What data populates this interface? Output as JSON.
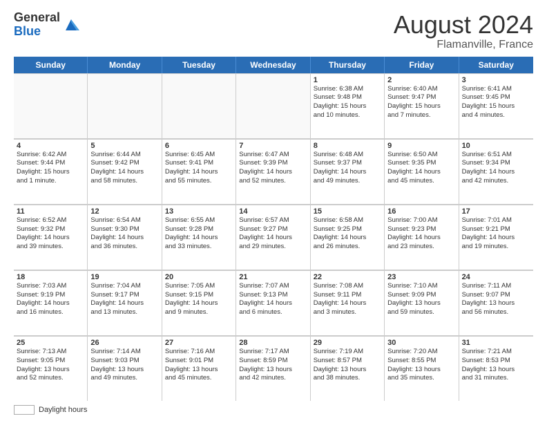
{
  "header": {
    "logo_general": "General",
    "logo_blue": "Blue",
    "month_year": "August 2024",
    "location": "Flamanville, France"
  },
  "calendar": {
    "days_of_week": [
      "Sunday",
      "Monday",
      "Tuesday",
      "Wednesday",
      "Thursday",
      "Friday",
      "Saturday"
    ],
    "rows": [
      [
        {
          "day": "",
          "lines": []
        },
        {
          "day": "",
          "lines": []
        },
        {
          "day": "",
          "lines": []
        },
        {
          "day": "",
          "lines": []
        },
        {
          "day": "1",
          "lines": [
            "Sunrise: 6:38 AM",
            "Sunset: 9:48 PM",
            "Daylight: 15 hours",
            "and 10 minutes."
          ]
        },
        {
          "day": "2",
          "lines": [
            "Sunrise: 6:40 AM",
            "Sunset: 9:47 PM",
            "Daylight: 15 hours",
            "and 7 minutes."
          ]
        },
        {
          "day": "3",
          "lines": [
            "Sunrise: 6:41 AM",
            "Sunset: 9:45 PM",
            "Daylight: 15 hours",
            "and 4 minutes."
          ]
        }
      ],
      [
        {
          "day": "4",
          "lines": [
            "Sunrise: 6:42 AM",
            "Sunset: 9:44 PM",
            "Daylight: 15 hours",
            "and 1 minute."
          ]
        },
        {
          "day": "5",
          "lines": [
            "Sunrise: 6:44 AM",
            "Sunset: 9:42 PM",
            "Daylight: 14 hours",
            "and 58 minutes."
          ]
        },
        {
          "day": "6",
          "lines": [
            "Sunrise: 6:45 AM",
            "Sunset: 9:41 PM",
            "Daylight: 14 hours",
            "and 55 minutes."
          ]
        },
        {
          "day": "7",
          "lines": [
            "Sunrise: 6:47 AM",
            "Sunset: 9:39 PM",
            "Daylight: 14 hours",
            "and 52 minutes."
          ]
        },
        {
          "day": "8",
          "lines": [
            "Sunrise: 6:48 AM",
            "Sunset: 9:37 PM",
            "Daylight: 14 hours",
            "and 49 minutes."
          ]
        },
        {
          "day": "9",
          "lines": [
            "Sunrise: 6:50 AM",
            "Sunset: 9:35 PM",
            "Daylight: 14 hours",
            "and 45 minutes."
          ]
        },
        {
          "day": "10",
          "lines": [
            "Sunrise: 6:51 AM",
            "Sunset: 9:34 PM",
            "Daylight: 14 hours",
            "and 42 minutes."
          ]
        }
      ],
      [
        {
          "day": "11",
          "lines": [
            "Sunrise: 6:52 AM",
            "Sunset: 9:32 PM",
            "Daylight: 14 hours",
            "and 39 minutes."
          ]
        },
        {
          "day": "12",
          "lines": [
            "Sunrise: 6:54 AM",
            "Sunset: 9:30 PM",
            "Daylight: 14 hours",
            "and 36 minutes."
          ]
        },
        {
          "day": "13",
          "lines": [
            "Sunrise: 6:55 AM",
            "Sunset: 9:28 PM",
            "Daylight: 14 hours",
            "and 33 minutes."
          ]
        },
        {
          "day": "14",
          "lines": [
            "Sunrise: 6:57 AM",
            "Sunset: 9:27 PM",
            "Daylight: 14 hours",
            "and 29 minutes."
          ]
        },
        {
          "day": "15",
          "lines": [
            "Sunrise: 6:58 AM",
            "Sunset: 9:25 PM",
            "Daylight: 14 hours",
            "and 26 minutes."
          ]
        },
        {
          "day": "16",
          "lines": [
            "Sunrise: 7:00 AM",
            "Sunset: 9:23 PM",
            "Daylight: 14 hours",
            "and 23 minutes."
          ]
        },
        {
          "day": "17",
          "lines": [
            "Sunrise: 7:01 AM",
            "Sunset: 9:21 PM",
            "Daylight: 14 hours",
            "and 19 minutes."
          ]
        }
      ],
      [
        {
          "day": "18",
          "lines": [
            "Sunrise: 7:03 AM",
            "Sunset: 9:19 PM",
            "Daylight: 14 hours",
            "and 16 minutes."
          ]
        },
        {
          "day": "19",
          "lines": [
            "Sunrise: 7:04 AM",
            "Sunset: 9:17 PM",
            "Daylight: 14 hours",
            "and 13 minutes."
          ]
        },
        {
          "day": "20",
          "lines": [
            "Sunrise: 7:05 AM",
            "Sunset: 9:15 PM",
            "Daylight: 14 hours",
            "and 9 minutes."
          ]
        },
        {
          "day": "21",
          "lines": [
            "Sunrise: 7:07 AM",
            "Sunset: 9:13 PM",
            "Daylight: 14 hours",
            "and 6 minutes."
          ]
        },
        {
          "day": "22",
          "lines": [
            "Sunrise: 7:08 AM",
            "Sunset: 9:11 PM",
            "Daylight: 14 hours",
            "and 3 minutes."
          ]
        },
        {
          "day": "23",
          "lines": [
            "Sunrise: 7:10 AM",
            "Sunset: 9:09 PM",
            "Daylight: 13 hours",
            "and 59 minutes."
          ]
        },
        {
          "day": "24",
          "lines": [
            "Sunrise: 7:11 AM",
            "Sunset: 9:07 PM",
            "Daylight: 13 hours",
            "and 56 minutes."
          ]
        }
      ],
      [
        {
          "day": "25",
          "lines": [
            "Sunrise: 7:13 AM",
            "Sunset: 9:05 PM",
            "Daylight: 13 hours",
            "and 52 minutes."
          ]
        },
        {
          "day": "26",
          "lines": [
            "Sunrise: 7:14 AM",
            "Sunset: 9:03 PM",
            "Daylight: 13 hours",
            "and 49 minutes."
          ]
        },
        {
          "day": "27",
          "lines": [
            "Sunrise: 7:16 AM",
            "Sunset: 9:01 PM",
            "Daylight: 13 hours",
            "and 45 minutes."
          ]
        },
        {
          "day": "28",
          "lines": [
            "Sunrise: 7:17 AM",
            "Sunset: 8:59 PM",
            "Daylight: 13 hours",
            "and 42 minutes."
          ]
        },
        {
          "day": "29",
          "lines": [
            "Sunrise: 7:19 AM",
            "Sunset: 8:57 PM",
            "Daylight: 13 hours",
            "and 38 minutes."
          ]
        },
        {
          "day": "30",
          "lines": [
            "Sunrise: 7:20 AM",
            "Sunset: 8:55 PM",
            "Daylight: 13 hours",
            "and 35 minutes."
          ]
        },
        {
          "day": "31",
          "lines": [
            "Sunrise: 7:21 AM",
            "Sunset: 8:53 PM",
            "Daylight: 13 hours",
            "and 31 minutes."
          ]
        }
      ]
    ]
  },
  "legend": {
    "label": "Daylight hours"
  }
}
